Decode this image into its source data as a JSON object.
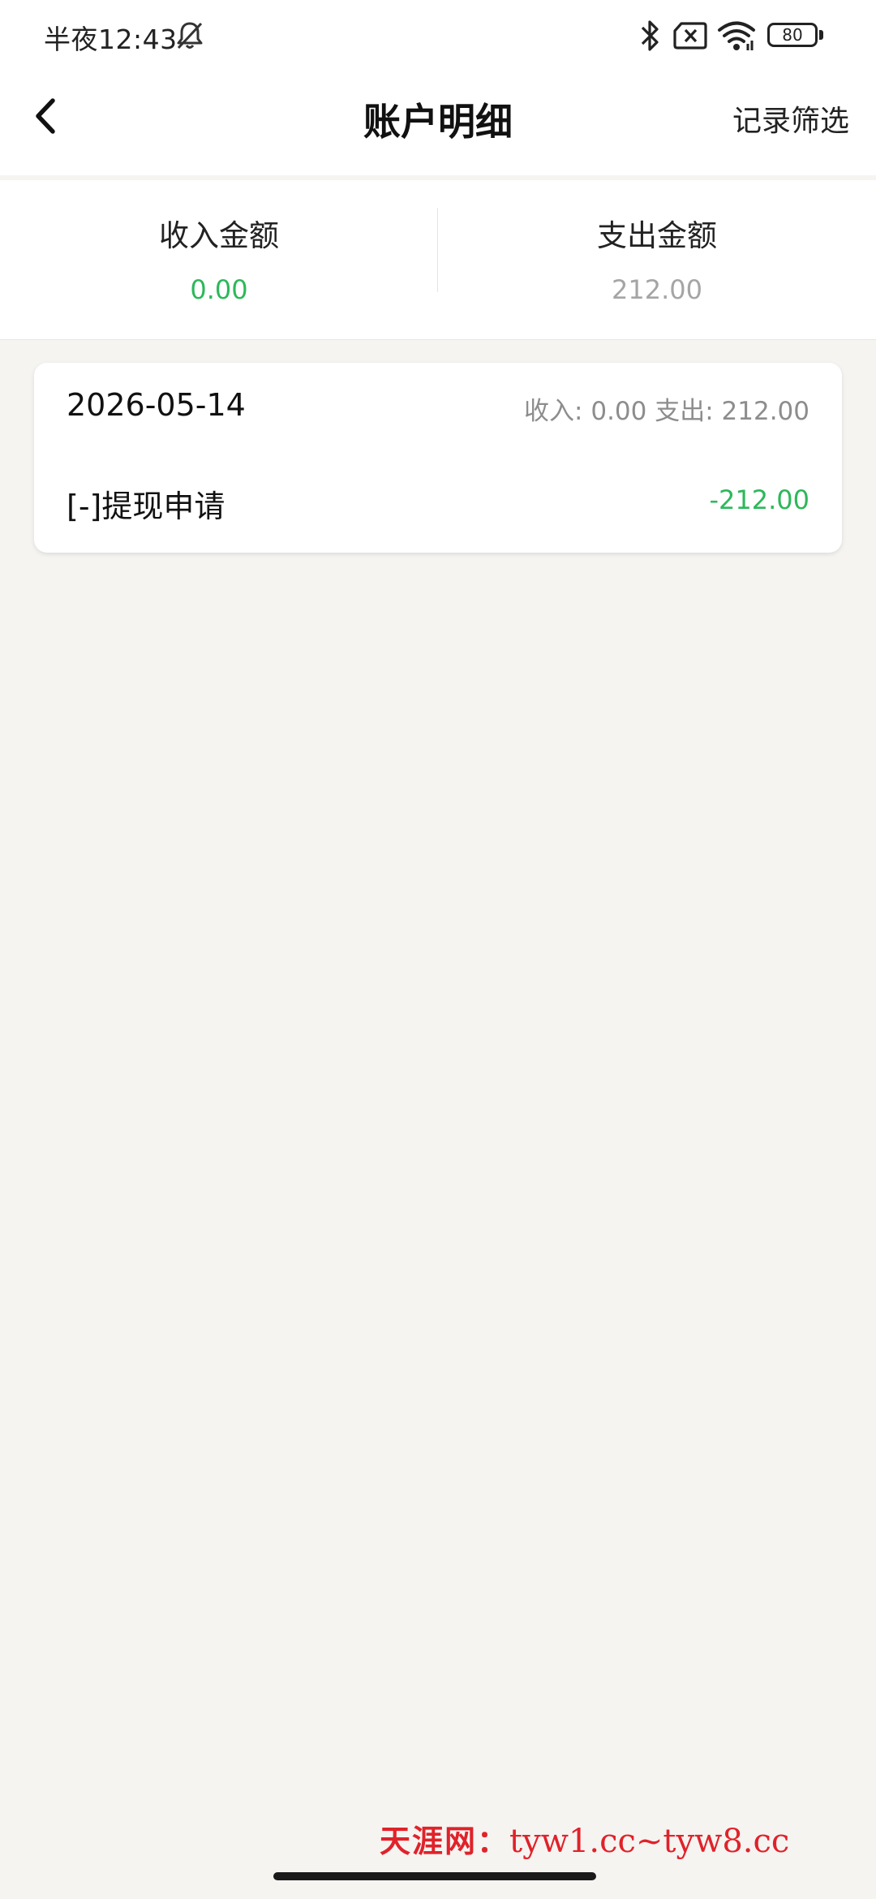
{
  "status_bar": {
    "time": "半夜12:43",
    "battery": "80"
  },
  "header": {
    "title": "账户明细",
    "filter_label": "记录筛选"
  },
  "summary": {
    "income_label": "收入金额",
    "income_value": "0.00",
    "expense_label": "支出金额",
    "expense_value": "212.00"
  },
  "records": [
    {
      "date": "2026-05-14",
      "daily_summary": "收入: 0.00 支出: 212.00",
      "items": [
        {
          "title": "[-]提现申请",
          "amount": "-212.00"
        }
      ]
    }
  ],
  "watermark": {
    "brand": "天涯网：",
    "url": "tyw1.cc~tyw8.cc"
  },
  "colors": {
    "accent_green": "#2db85a",
    "muted_gray": "#a5a5a5",
    "watermark_red": "#e0222a",
    "background": "#f5f4f1"
  },
  "icons": [
    "mute-bell-icon",
    "bluetooth-icon",
    "sim-off-icon",
    "wifi-icon",
    "battery-icon",
    "back-chevron-icon"
  ]
}
